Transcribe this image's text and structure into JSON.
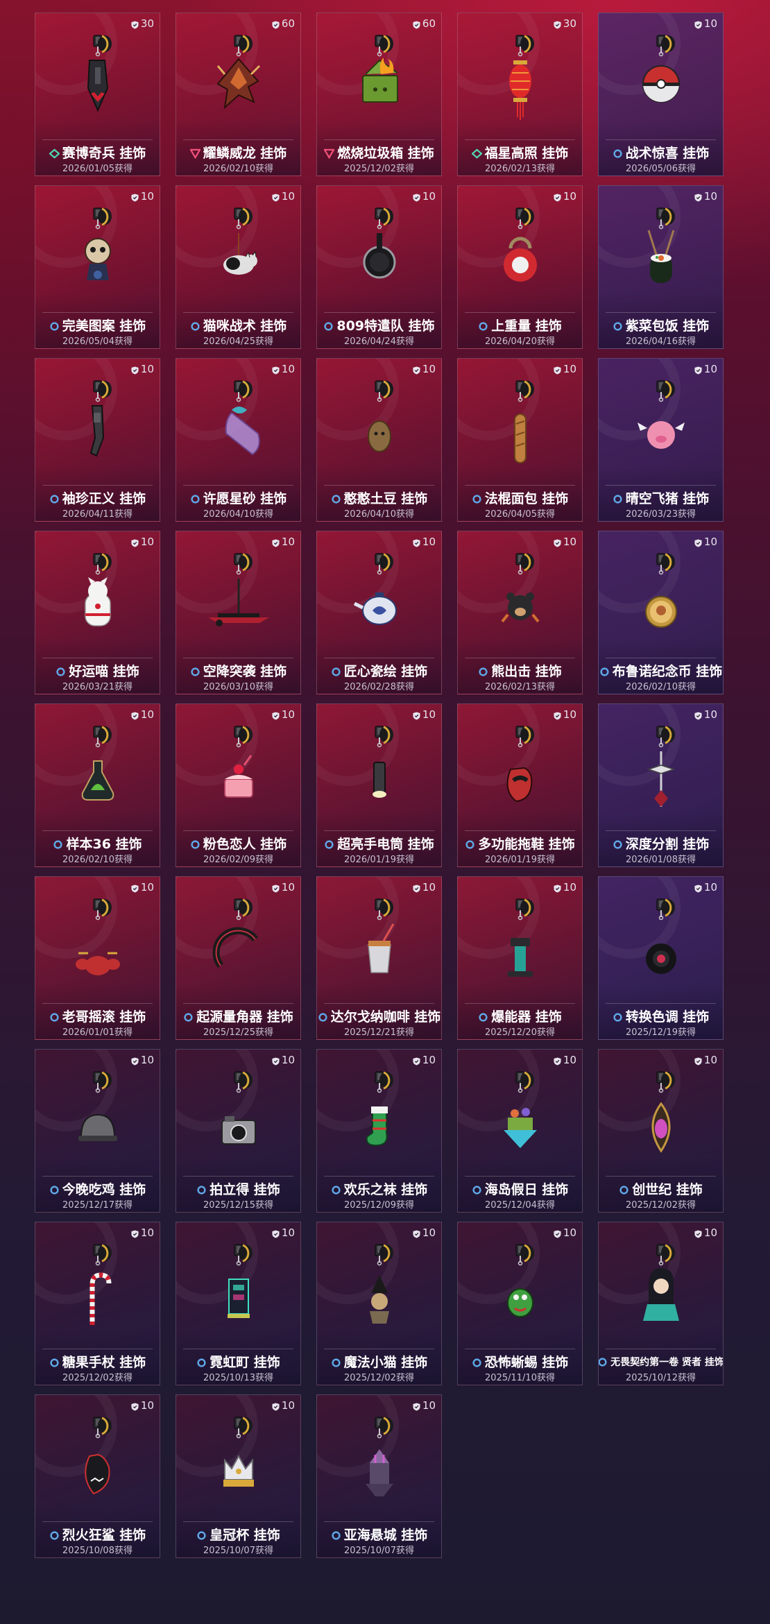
{
  "items": [
    {
      "name": "赛博奇兵 挂饰",
      "date": "2026/01/05获得",
      "value": "30",
      "rarity": "green",
      "art": "cyber"
    },
    {
      "name": "耀鳞威龙 挂饰",
      "date": "2026/02/10获得",
      "value": "60",
      "rarity": "pink",
      "art": "dragon"
    },
    {
      "name": "燃烧垃圾箱 挂饰",
      "date": "2025/12/02获得",
      "value": "60",
      "rarity": "pink",
      "art": "trash"
    },
    {
      "name": "福星高照 挂饰",
      "date": "2026/02/13获得",
      "value": "30",
      "rarity": "green",
      "art": "lantern"
    },
    {
      "name": "战术惊喜 挂饰",
      "date": "2026/05/06获得",
      "value": "10",
      "rarity": "blue",
      "art": "orb"
    },
    {
      "name": "完美图案 挂饰",
      "date": "2026/05/04获得",
      "value": "10",
      "rarity": "blue",
      "art": "doll"
    },
    {
      "name": "猫咪战术 挂饰",
      "date": "2026/04/25获得",
      "value": "10",
      "rarity": "blue",
      "art": "cat"
    },
    {
      "name": "809特遣队 挂饰",
      "date": "2026/04/24获得",
      "value": "10",
      "rarity": "blue",
      "art": "pan"
    },
    {
      "name": "上重量 挂饰",
      "date": "2026/04/20获得",
      "value": "10",
      "rarity": "blue",
      "art": "kettlebell"
    },
    {
      "name": "紫菜包饭 挂饰",
      "date": "2026/04/16获得",
      "value": "10",
      "rarity": "blue",
      "art": "sushi"
    },
    {
      "name": "袖珍正义 挂饰",
      "date": "2026/04/11获得",
      "value": "10",
      "rarity": "blue",
      "art": "gun"
    },
    {
      "name": "许愿星砂 挂饰",
      "date": "2026/04/10获得",
      "value": "10",
      "rarity": "blue",
      "art": "jar"
    },
    {
      "name": "憨憨土豆 挂饰",
      "date": "2026/04/10获得",
      "value": "10",
      "rarity": "blue",
      "art": "potato"
    },
    {
      "name": "法棍面包 挂饰",
      "date": "2026/04/05获得",
      "value": "10",
      "rarity": "blue",
      "art": "bread"
    },
    {
      "name": "晴空飞猪 挂饰",
      "date": "2026/03/23获得",
      "value": "10",
      "rarity": "blue",
      "art": "pig"
    },
    {
      "name": "好运喵 挂饰",
      "date": "2026/03/21获得",
      "value": "10",
      "rarity": "blue",
      "art": "luckycat"
    },
    {
      "name": "空降突袭 挂饰",
      "date": "2026/03/10获得",
      "value": "10",
      "rarity": "blue",
      "art": "plane"
    },
    {
      "name": "匠心瓷绘 挂饰",
      "date": "2026/02/28获得",
      "value": "10",
      "rarity": "blue",
      "art": "teapot"
    },
    {
      "name": "熊出击 挂饰",
      "date": "2026/02/13获得",
      "value": "10",
      "rarity": "blue",
      "art": "bear"
    },
    {
      "name": "布鲁诺纪念币 挂饰",
      "date": "2026/02/10获得",
      "value": "10",
      "rarity": "blue",
      "art": "coin"
    },
    {
      "name": "样本36 挂饰",
      "date": "2026/02/10获得",
      "value": "10",
      "rarity": "blue",
      "art": "flask"
    },
    {
      "name": "粉色恋人 挂饰",
      "date": "2026/02/09获得",
      "value": "10",
      "rarity": "blue",
      "art": "cake"
    },
    {
      "name": "超亮手电筒 挂饰",
      "date": "2026/01/19获得",
      "value": "10",
      "rarity": "blue",
      "art": "flashlight"
    },
    {
      "name": "多功能拖鞋 挂饰",
      "date": "2026/01/19获得",
      "value": "10",
      "rarity": "blue",
      "art": "slipper"
    },
    {
      "name": "深度分割 挂饰",
      "date": "2026/01/08获得",
      "value": "10",
      "rarity": "blue",
      "art": "blade"
    },
    {
      "name": "老哥摇滚 挂饰",
      "date": "2026/01/01获得",
      "value": "10",
      "rarity": "blue",
      "art": "drums"
    },
    {
      "name": "起源量角器 挂饰",
      "date": "2025/12/25获得",
      "value": "10",
      "rarity": "blue",
      "art": "protractor"
    },
    {
      "name": "达尔戈纳咖啡 挂饰",
      "date": "2025/12/21获得",
      "value": "10",
      "rarity": "blue",
      "art": "coffee"
    },
    {
      "name": "爆能器 挂饰",
      "date": "2025/12/20获得",
      "value": "10",
      "rarity": "blue",
      "art": "blaster"
    },
    {
      "name": "转换色调 挂饰",
      "date": "2025/12/19获得",
      "value": "10",
      "rarity": "blue",
      "art": "tire"
    },
    {
      "name": "今晚吃鸡 挂饰",
      "date": "2025/12/17获得",
      "value": "10",
      "rarity": "blue",
      "art": "helmet"
    },
    {
      "name": "拍立得 挂饰",
      "date": "2025/12/15获得",
      "value": "10",
      "rarity": "blue",
      "art": "camera"
    },
    {
      "name": "欢乐之袜 挂饰",
      "date": "2025/12/09获得",
      "value": "10",
      "rarity": "blue",
      "art": "stocking"
    },
    {
      "name": "海岛假日 挂饰",
      "date": "2025/12/04获得",
      "value": "10",
      "rarity": "blue",
      "art": "island"
    },
    {
      "name": "创世纪 挂饰",
      "date": "2025/12/02获得",
      "value": "10",
      "rarity": "blue",
      "art": "seed"
    },
    {
      "name": "糖果手杖 挂饰",
      "date": "2025/12/02获得",
      "value": "10",
      "rarity": "blue",
      "art": "candycane"
    },
    {
      "name": "霓虹町 挂饰",
      "date": "2025/10/13获得",
      "value": "10",
      "rarity": "blue",
      "art": "neon"
    },
    {
      "name": "魔法小猫 挂饰",
      "date": "2025/12/02获得",
      "value": "10",
      "rarity": "blue",
      "art": "witchcat"
    },
    {
      "name": "恐怖蜥蜴 挂饰",
      "date": "2025/11/10获得",
      "value": "10",
      "rarity": "blue",
      "art": "lizard"
    },
    {
      "name": "无畏契约第一卷 贤者 挂饰",
      "date": "2025/10/12获得",
      "value": "10",
      "rarity": "blue",
      "art": "sage"
    },
    {
      "name": "烈火狂鲨 挂饰",
      "date": "2025/10/08获得",
      "value": "10",
      "rarity": "blue",
      "art": "shark"
    },
    {
      "name": "皇冠杯 挂饰",
      "date": "2025/10/07获得",
      "value": "10",
      "rarity": "blue",
      "art": "crown"
    },
    {
      "name": "亚海悬城 挂饰",
      "date": "2025/10/07获得",
      "value": "10",
      "rarity": "blue",
      "art": "castle"
    }
  ],
  "colors": {
    "green": "#4fd6b0",
    "pink": "#f0507a",
    "blue": "#5fa8e8",
    "gold": "#d9a93a"
  }
}
